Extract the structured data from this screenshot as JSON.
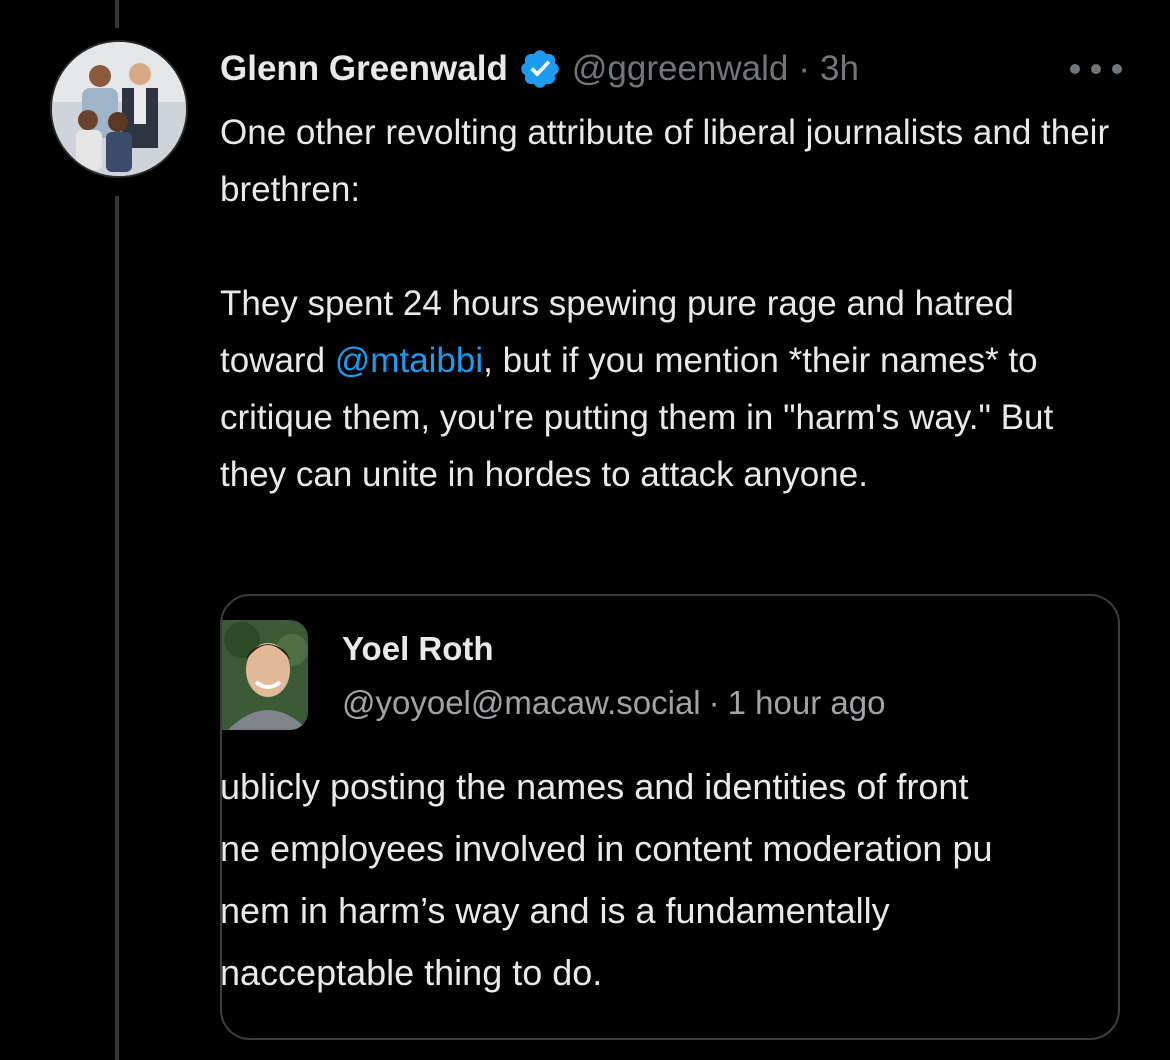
{
  "tweet": {
    "author": {
      "display_name": "Glenn Greenwald",
      "handle": "@ggreenwald",
      "separator": "·",
      "time": "3h",
      "verified": true,
      "verified_color": "#1d9bf0"
    },
    "more_icon": "more-horizontal-icon",
    "text": {
      "para1": "One other revolting attribute of liberal journalists and their brethren:",
      "para2_before_mention": "They spent 24 hours spewing pure rage and hatred toward ",
      "mention": "@mtaibbi",
      "para2_after_mention": ", but if you mention *their names* to critique them, you're putting them in \"harm's way.\" But they can unite in hordes to attack anyone."
    },
    "mention_color": "#1d9bf0"
  },
  "quoted_post": {
    "author_name": "Yoel Roth",
    "author_handle": "@yoyoel@macaw.social",
    "separator": "·",
    "time": "1 hour ago",
    "lines": [
      "ublicly posting the names and identities of front",
      "ne employees involved in content moderation pu",
      "nem in harm’s way and is a fundamentally",
      "nacceptable thing to do."
    ]
  },
  "colors": {
    "background": "#000000",
    "text_primary": "#e7e9ea",
    "text_secondary": "#71767b",
    "accent": "#1d9bf0",
    "border": "#3a3d42"
  }
}
